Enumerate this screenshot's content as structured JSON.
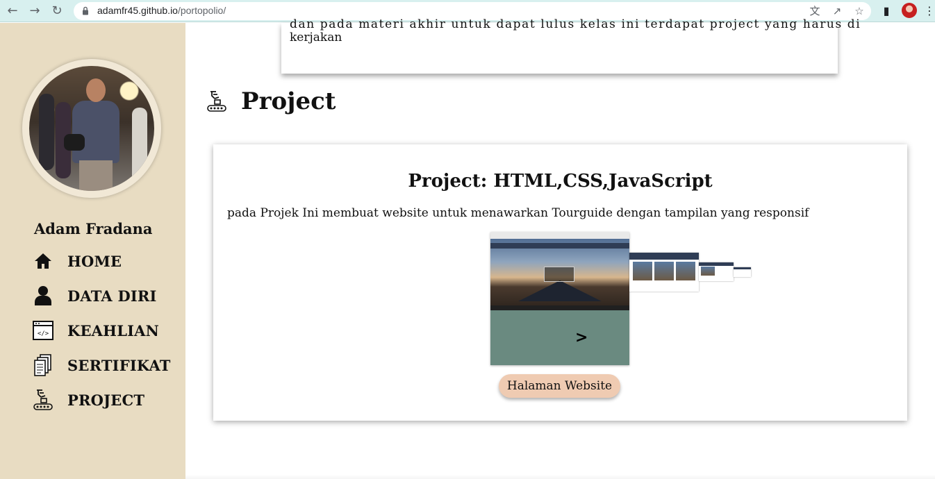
{
  "browser": {
    "url_host": "adamfr45.github.io",
    "url_path": "/portopolio/"
  },
  "sidebar": {
    "name": "Adam Fradana",
    "items": [
      {
        "label": "HOME",
        "icon": "home-icon"
      },
      {
        "label": "DATA DIRI",
        "icon": "person-icon"
      },
      {
        "label": "KEAHLIAN",
        "icon": "code-window-icon"
      },
      {
        "label": "SERTIFIKAT",
        "icon": "documents-icon"
      },
      {
        "label": "PROJECT",
        "icon": "conveyor-icon"
      }
    ]
  },
  "previous_card": {
    "line1": "dan pada materi akhir untuk dapat lulus kelas ini terdapat project yang harus di",
    "line2": "kerjakan"
  },
  "section": {
    "title": "Project"
  },
  "project": {
    "title": "Project: HTML,CSS,JavaScript",
    "description": "pada Projek Ini membuat website untuk menawarkan Tourguide dengan tampilan yang responsif",
    "next_label": ">",
    "button_label": "Halaman Website"
  },
  "colors": {
    "sidebar_bg": "#e8dcc2",
    "button_bg": "#efcbb2",
    "browser_bar": "#d8f0ef",
    "carousel_bg": "#6a8a80"
  }
}
